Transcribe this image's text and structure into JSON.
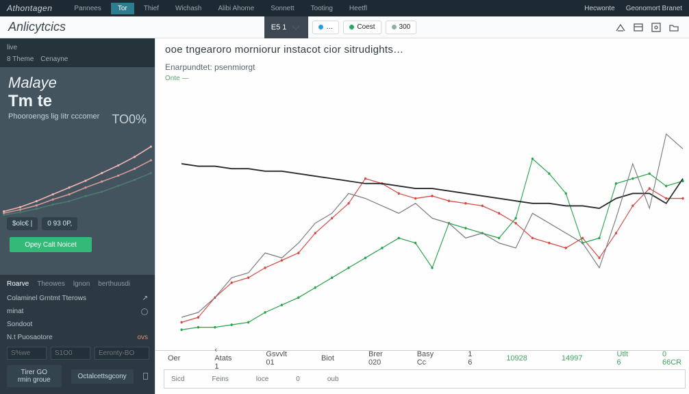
{
  "brand": "Athontagen",
  "nav_tabs": [
    "Pannees",
    "Tor",
    "Thief",
    "Wichash",
    "Alibi Ahome",
    "Sonnett",
    "Tooting",
    "Heetfl"
  ],
  "nav_active_index": 1,
  "nav_right": [
    "Hecwonte",
    "Geonomort Branet"
  ],
  "subnav_title": "Anlicytcics",
  "center_dark_label": "E5  1",
  "center_pills": [
    {
      "dot": "blue",
      "label": "…"
    },
    {
      "dot": "green",
      "label": "Coest"
    },
    {
      "dot": "gray",
      "label": "300"
    }
  ],
  "sidebar": {
    "live_label": "live",
    "tabs": [
      "8 Theme",
      "Cenayne"
    ],
    "card_h1": "Malaye",
    "card_h2": "Tm te",
    "sub_left": "Phooroengs\nlig Iitr cccomer",
    "sub_right": "TO0%",
    "badges": [
      "$olc€  |",
      "0  93  0P,"
    ],
    "cta_label": "Opey Calt Noicet",
    "panel2_tabs": [
      "Roarve",
      "Theowes",
      "lgnon",
      "berthuusdi"
    ],
    "panel2_rowsA": [
      {
        "label": "Colaminel Grntmt Tterows",
        "icon": "share"
      },
      {
        "label": "minat"
      }
    ],
    "panel2_rowsB": [
      {
        "label": "Sondoot"
      },
      {
        "label": "N.t Puosaotore",
        "value": "ovs"
      }
    ],
    "panel2_fields": [
      "S%we",
      "S1O0",
      "Eeronty-BO"
    ],
    "panel2_buttons": [
      "Tirer GO rmin groue",
      "Octalcettsgcony"
    ]
  },
  "chart": {
    "title": "ooe tngearoro morniorur instacot cior sitrudights…",
    "subtitle": "Enarpundtet: psenmiorgt",
    "tiny": "Onte  —",
    "xlabels": [
      "Oer",
      "‹  Atats 1",
      "Gsvvlt 01",
      "Biot",
      "Brer 020",
      "Basy Cc",
      "1 6",
      "10928",
      "14997",
      "Utlt 6",
      "0  66CR"
    ],
    "legend": [
      "Sicd",
      "Feins",
      "loce",
      "0",
      "oub"
    ]
  },
  "chart_data": {
    "type": "line",
    "title": "ooe tngearoro morniorur instacot cior sitrudights",
    "subtitle": "Enarpundtet: psenmiorgt",
    "xlabel": "",
    "ylabel": "",
    "ylim": [
      0,
      100
    ],
    "x": [
      0,
      1,
      2,
      3,
      4,
      5,
      6,
      7,
      8,
      9,
      10,
      11,
      12,
      13,
      14,
      15,
      16,
      17,
      18,
      19,
      20,
      21,
      22,
      23,
      24,
      25,
      26,
      27,
      28,
      29,
      30
    ],
    "series": [
      {
        "name": "red-series",
        "color": "#d34a44",
        "values": [
          8,
          10,
          18,
          24,
          26,
          30,
          33,
          36,
          44,
          50,
          56,
          66,
          64,
          60,
          58,
          59,
          57,
          56,
          55,
          52,
          48,
          42,
          40,
          38,
          42,
          34,
          44,
          55,
          62,
          58,
          58
        ]
      },
      {
        "name": "green-series",
        "color": "#29a24b",
        "values": [
          5,
          6,
          6,
          7,
          8,
          12,
          15,
          18,
          22,
          26,
          30,
          34,
          38,
          42,
          40,
          30,
          48,
          46,
          44,
          42,
          50,
          74,
          68,
          60,
          40,
          42,
          64,
          66,
          68,
          63,
          65
        ]
      },
      {
        "name": "black-trend",
        "color": "#26292b",
        "values": [
          72,
          71,
          71,
          70,
          70,
          69,
          69,
          68,
          67,
          66,
          65,
          64,
          64,
          63,
          62,
          62,
          61,
          60,
          59,
          58,
          57,
          56,
          56,
          55,
          55,
          54,
          58,
          60,
          60,
          56,
          66
        ]
      },
      {
        "name": "black-volatile",
        "color": "#777a7c",
        "values": [
          10,
          12,
          18,
          26,
          28,
          36,
          34,
          40,
          48,
          52,
          60,
          58,
          55,
          52,
          56,
          50,
          48,
          42,
          44,
          40,
          38,
          52,
          48,
          44,
          40,
          30,
          50,
          72,
          54,
          84,
          78
        ]
      }
    ]
  },
  "spark_data": {
    "x": [
      0,
      1,
      2,
      3,
      4,
      5,
      6,
      7,
      8,
      9
    ],
    "series": [
      {
        "color": "#f4b7b6",
        "values": [
          10,
          15,
          22,
          30,
          38,
          46,
          55,
          64,
          74,
          86
        ]
      },
      {
        "color": "#d89b98",
        "values": [
          8,
          12,
          17,
          24,
          30,
          38,
          45,
          52,
          60,
          70
        ]
      },
      {
        "color": "#4a7c71",
        "values": [
          6,
          9,
          13,
          18,
          22,
          28,
          33,
          40,
          47,
          55
        ]
      }
    ]
  }
}
